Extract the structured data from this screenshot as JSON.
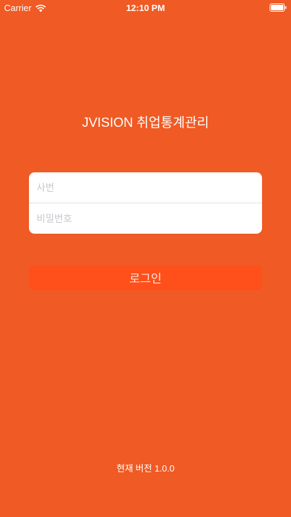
{
  "status_bar": {
    "carrier": "Carrier",
    "time": "12:10 PM",
    "icons": [
      "wifi-icon",
      "battery-icon"
    ]
  },
  "app": {
    "title": "JVISION 취업통계관리"
  },
  "login": {
    "employee_id_placeholder": "사번",
    "employee_id_value": "",
    "password_placeholder": "비밀번호",
    "password_value": "",
    "button_label": "로그인"
  },
  "footer": {
    "version": "현재 버전 1.0.0"
  },
  "colors": {
    "background": "#F05A24",
    "button": "#FF4F1A",
    "field_background": "#FFFFFF"
  }
}
